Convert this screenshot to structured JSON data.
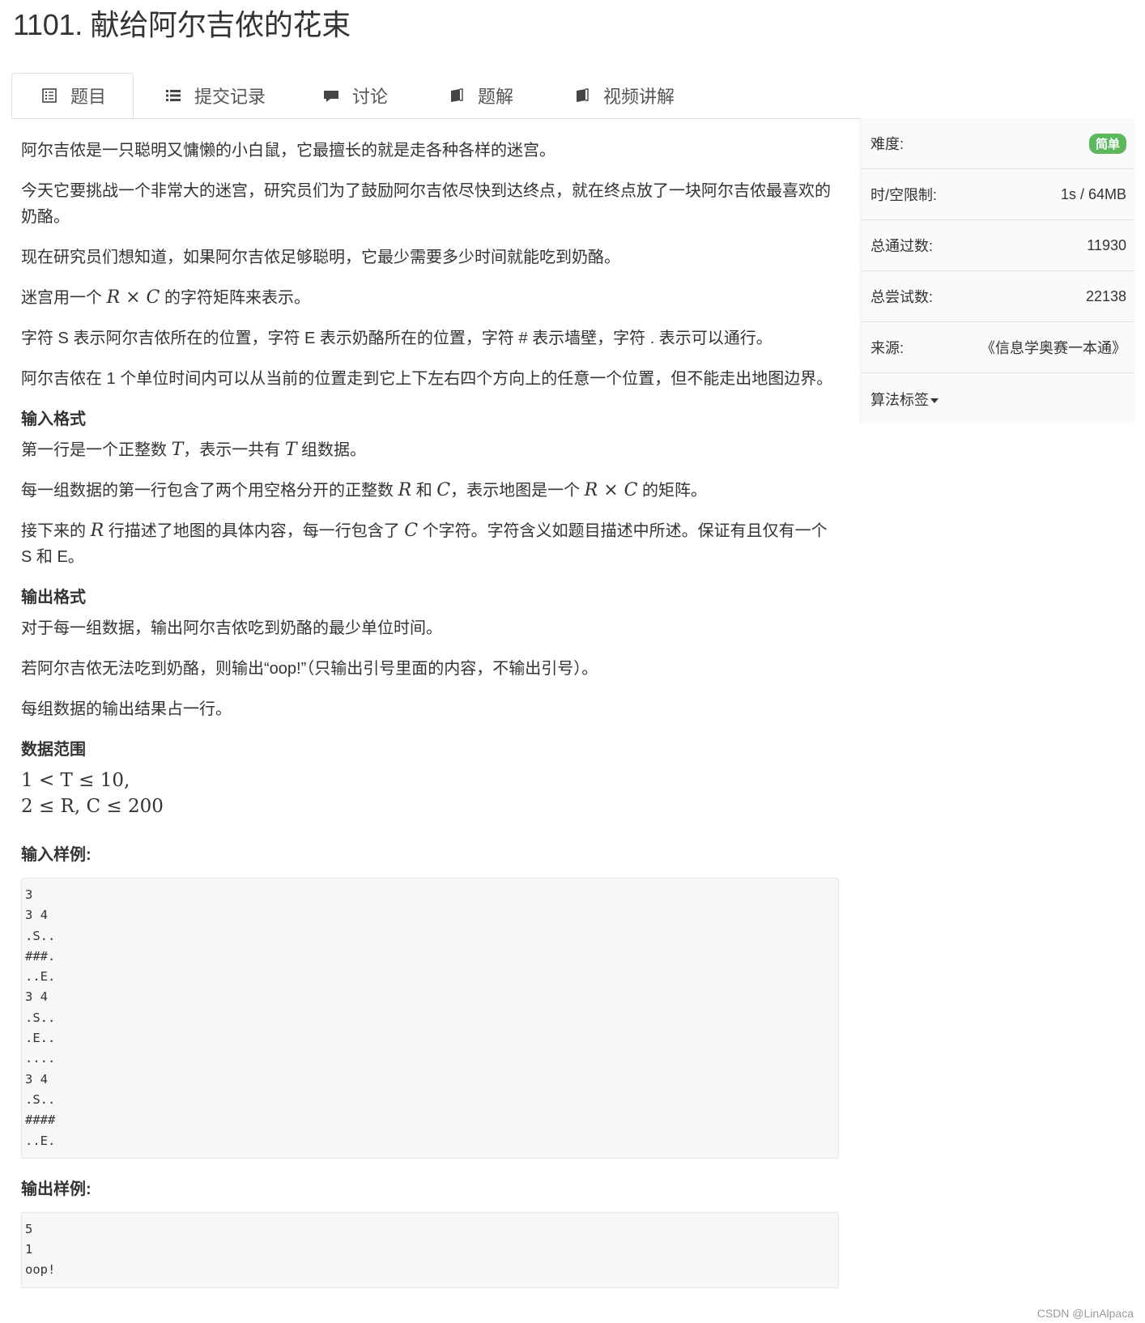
{
  "title": "1101. 献给阿尔吉侬的花束",
  "tabs": [
    {
      "label": "题目",
      "icon": "document-list-icon"
    },
    {
      "label": "提交记录",
      "icon": "list-icon"
    },
    {
      "label": "讨论",
      "icon": "comment-icon"
    },
    {
      "label": "题解",
      "icon": "book-icon"
    },
    {
      "label": "视频讲解",
      "icon": "book-icon"
    }
  ],
  "problem": {
    "p1": "阿尔吉侬是一只聪明又慵懒的小白鼠，它最擅长的就是走各种各样的迷宫。",
    "p2": "今天它要挑战一个非常大的迷宫，研究员们为了鼓励阿尔吉侬尽快到达终点，就在终点放了一块阿尔吉侬最喜欢的奶酪。",
    "p3": "现在研究员们想知道，如果阿尔吉侬足够聪明，它最少需要多少时间就能吃到奶酪。",
    "p4a": "迷宫用一个 ",
    "p4b": " 的字符矩阵来表示。",
    "p5": "字符 S 表示阿尔吉侬所在的位置，字符 E 表示奶酪所在的位置，字符 # 表示墙壁，字符 . 表示可以通行。",
    "p6": "阿尔吉侬在 1 个单位时间内可以从当前的位置走到它上下左右四个方向上的任意一个位置，但不能走出地图边界。",
    "input_title": "输入格式",
    "in1a": "第一行是一个正整数 ",
    "in1b": "，表示一共有 ",
    "in1c": " 组数据。",
    "in2a": "每一组数据的第一行包含了两个用空格分开的正整数 ",
    "in2b": " 和 ",
    "in2c": "，表示地图是一个 ",
    "in2d": " 的矩阵。",
    "in3a": "接下来的 ",
    "in3b": " 行描述了地图的具体内容，每一行包含了 ",
    "in3c": " 个字符。字符含义如题目描述中所述。保证有且仅有一个 S 和 E。",
    "output_title": "输出格式",
    "out1": "对于每一组数据，输出阿尔吉侬吃到奶酪的最少单位时间。",
    "out2": "若阿尔吉侬无法吃到奶酪，则输出“oop!”（只输出引号里面的内容，不输出引号）。",
    "out3": "每组数据的输出结果占一行。",
    "range_title": "数据范围",
    "range1": "1 < T ≤ 10,",
    "range2": "2 ≤ R, C ≤ 200",
    "sample_in_title": "输入样例:",
    "sample_in": "3\n3 4\n.S..\n###.\n..E.\n3 4\n.S..\n.E..\n....\n3 4\n.S..\n####\n..E.",
    "sample_out_title": "输出样例:",
    "sample_out": "5\n1\noop!"
  },
  "math": {
    "RxC": "R × C",
    "T": "T",
    "R": "R",
    "C": "C"
  },
  "sidebar": {
    "difficulty_label": "难度:",
    "difficulty_value": "简单",
    "limit_label": "时/空限制:",
    "limit_value": "1s / 64MB",
    "passed_label": "总通过数:",
    "passed_value": "11930",
    "tried_label": "总尝试数:",
    "tried_value": "22138",
    "source_label": "来源:",
    "source_value": "《信息学奥赛一本通》",
    "tags_label": "算法标签"
  },
  "colors": {
    "badge": "#5cb85c"
  },
  "footer": "CSDN @LinAlpaca"
}
